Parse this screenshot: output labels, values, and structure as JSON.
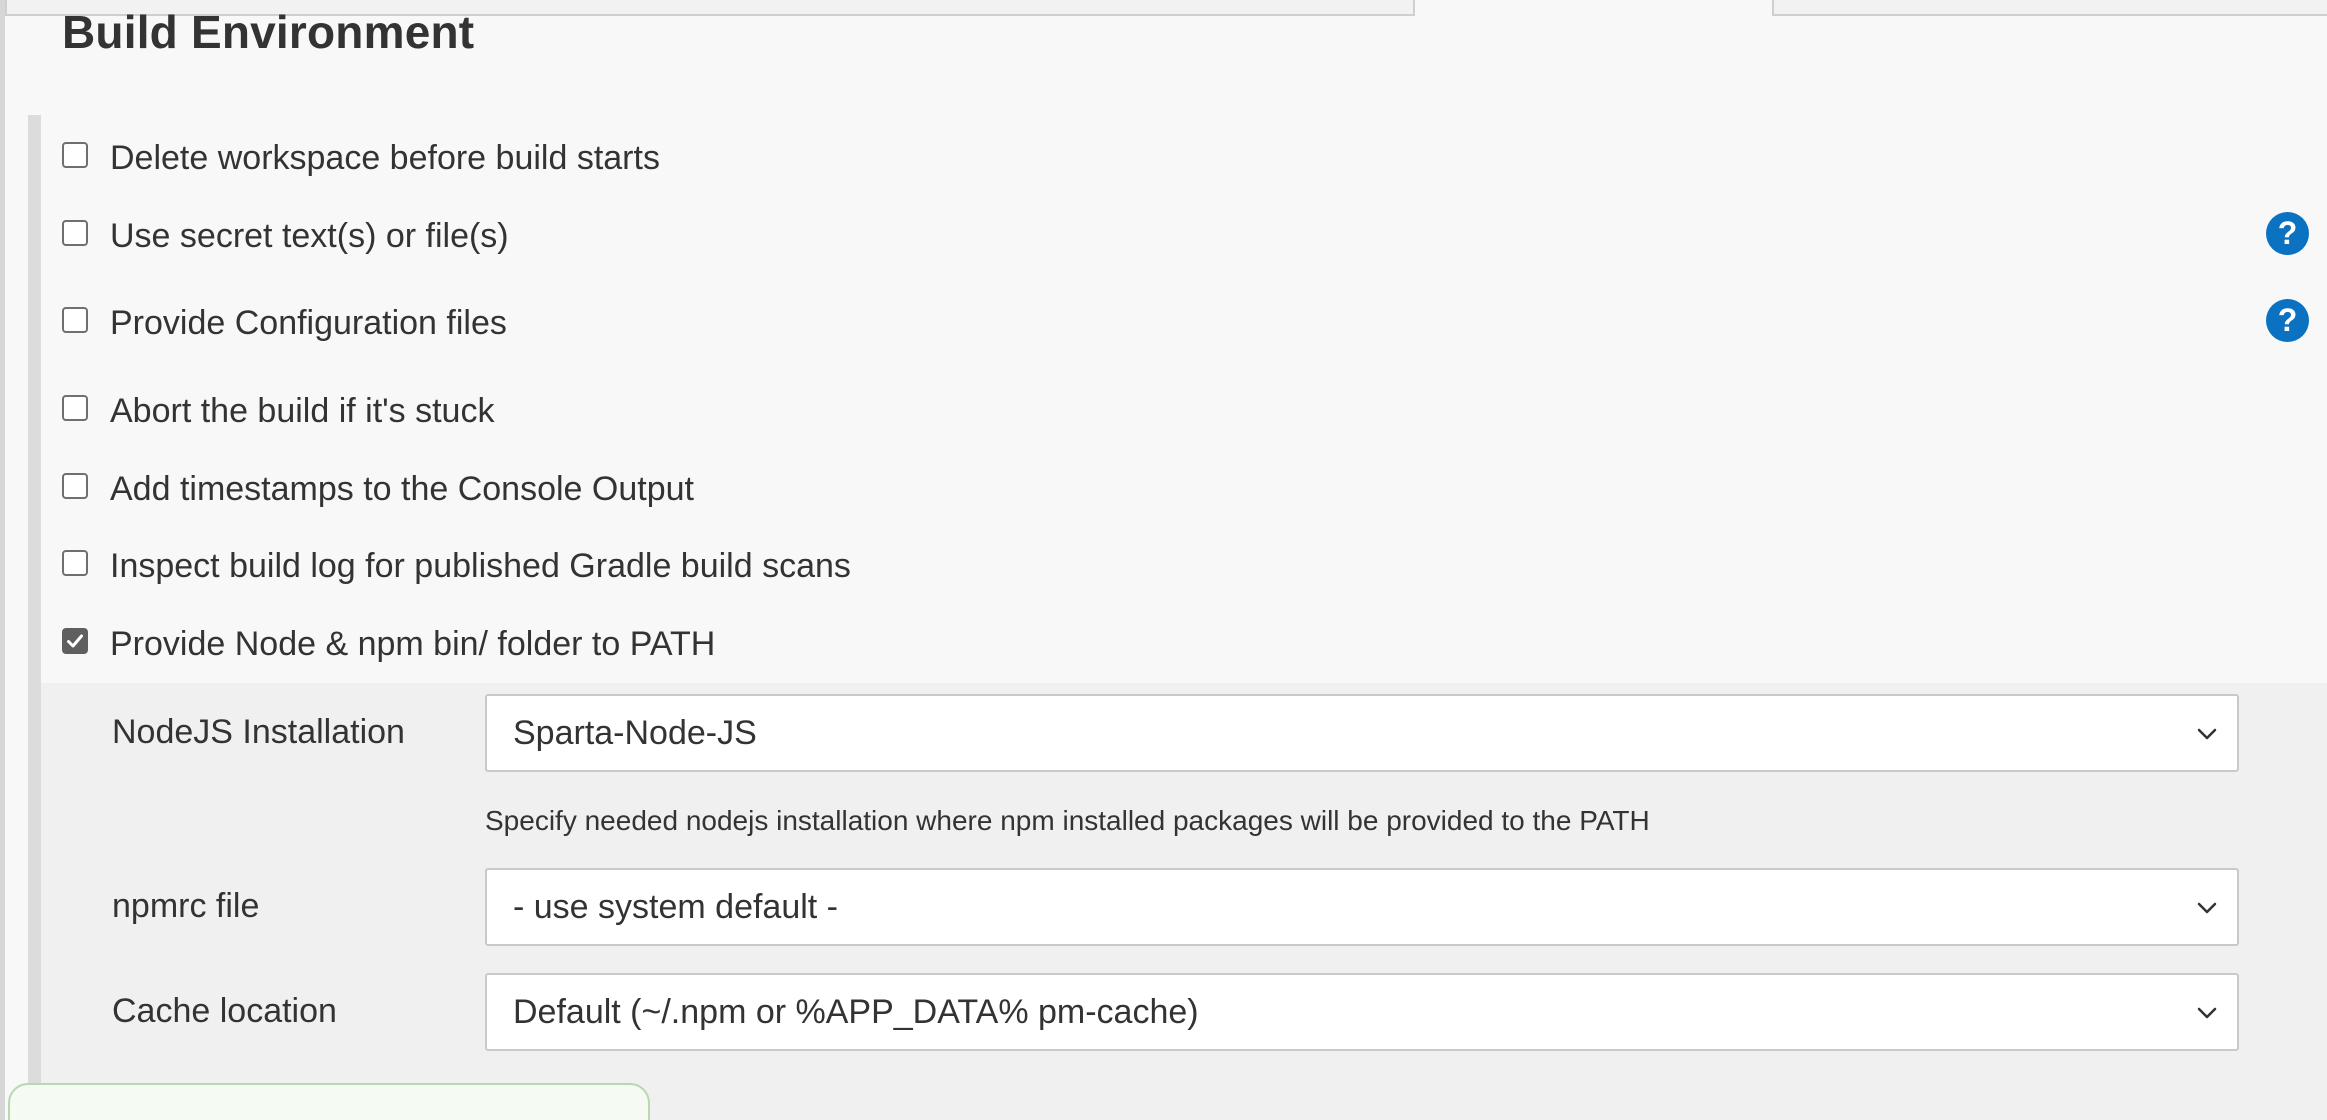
{
  "section": {
    "title": "Build Environment"
  },
  "options": [
    {
      "label": "Delete workspace before build starts",
      "checked": false,
      "help": false
    },
    {
      "label": "Use secret text(s) or file(s)",
      "checked": false,
      "help": true
    },
    {
      "label": "Provide Configuration files",
      "checked": false,
      "help": true
    },
    {
      "label": "Abort the build if it's stuck",
      "checked": false,
      "help": false
    },
    {
      "label": "Add timestamps to the Console Output",
      "checked": false,
      "help": false
    },
    {
      "label": "Inspect build log for published Gradle build scans",
      "checked": false,
      "help": false
    },
    {
      "label": "Provide Node & npm bin/ folder to PATH",
      "checked": true,
      "help": false
    }
  ],
  "help_icon": {
    "glyph": "?",
    "name": "help-icon",
    "color": "#0b72c1"
  },
  "node_config": {
    "nodejs_installation": {
      "label": "NodeJS Installation",
      "value": "Sparta-Node-JS",
      "description": "Specify needed nodejs installation where npm installed packages will be provided to the PATH"
    },
    "npmrc_file": {
      "label": "npmrc file",
      "value": "- use system default -"
    },
    "cache_location": {
      "label": "Cache location",
      "value": "Default (~/.npm or %APP_DATA% pm-cache)"
    }
  },
  "colors": {
    "accent": "#0b72c1",
    "checkbox_checked": "#5f5f5f",
    "background": "#f8f8f8"
  }
}
